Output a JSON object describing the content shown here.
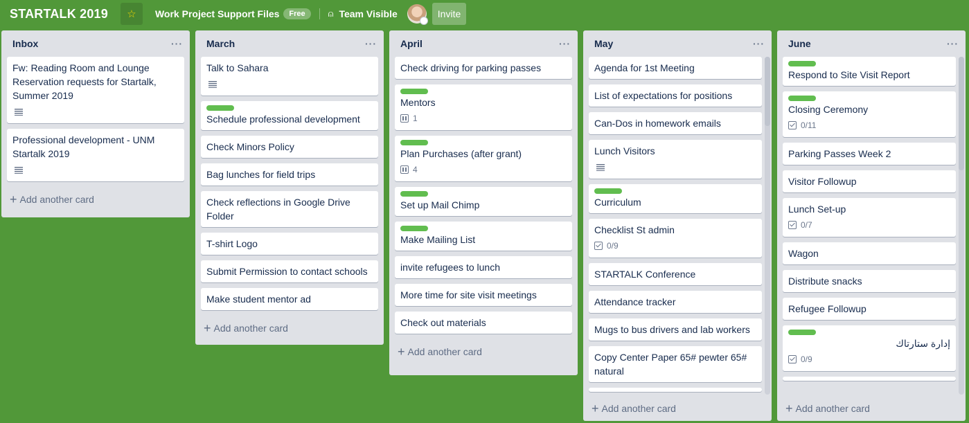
{
  "header": {
    "board_title": "STARTALK 2019",
    "star_icon": "star-icon",
    "team_name": "Work Project Support Files",
    "team_badge": "Free",
    "visibility_icon": "team-visibility-icon",
    "visibility_label": "Team Visible",
    "invite_label": "Invite"
  },
  "colors": {
    "board_bg": "#519839",
    "list_bg": "#dfe1e6",
    "label_green": "#61bd4f",
    "star": "#f2d600"
  },
  "add_card_label": "Add another card",
  "lists": [
    {
      "title": "Inbox",
      "cards": [
        {
          "title": "Fw: Reading Room and Lounge Reservation requests for Startalk, Summer 2019",
          "has_description": true
        },
        {
          "title": "Professional development - UNM Startalk 2019",
          "has_description": true
        }
      ]
    },
    {
      "title": "March",
      "cards": [
        {
          "title": "Talk to Sahara",
          "has_description": true
        },
        {
          "title": "Schedule professional development",
          "label": true
        },
        {
          "title": "Check Minors Policy"
        },
        {
          "title": "Bag lunches for field trips"
        },
        {
          "title": "Check reflections in Google Drive Folder"
        },
        {
          "title": "T-shirt Logo"
        },
        {
          "title": "Submit Permission to contact schools"
        },
        {
          "title": "Make student mentor ad"
        }
      ]
    },
    {
      "title": "April",
      "cards": [
        {
          "title": "Check driving for parking passes"
        },
        {
          "title": "Mentors",
          "label": true,
          "attachments": "1"
        },
        {
          "title": "Plan Purchases (after grant)",
          "label": true,
          "attachments": "4"
        },
        {
          "title": "Set up Mail Chimp",
          "label": true
        },
        {
          "title": "Make Mailing List",
          "label": true
        },
        {
          "title": "invite refugees to lunch"
        },
        {
          "title": "More time for site visit meetings"
        },
        {
          "title": "Check out materials"
        }
      ]
    },
    {
      "title": "May",
      "cards": [
        {
          "title": "Agenda for 1st Meeting"
        },
        {
          "title": "List of expectations for positions"
        },
        {
          "title": "Can-Dos in homework emails"
        },
        {
          "title": "Lunch Visitors",
          "has_description": true
        },
        {
          "title": "Curriculum",
          "label": true
        },
        {
          "title": "Checklist St admin",
          "checklist": "0/9"
        },
        {
          "title": "STARTALK Conference"
        },
        {
          "title": "Attendance tracker"
        },
        {
          "title": "Mugs to bus drivers and lab workers"
        },
        {
          "title": "Copy Center Paper 65# pewter 65# natural"
        }
      ]
    },
    {
      "title": "June",
      "cards": [
        {
          "title": "Respond to Site Visit Report",
          "label": true
        },
        {
          "title": "Closing Ceremony",
          "label": true,
          "checklist": "0/11"
        },
        {
          "title": "Parking Passes Week 2"
        },
        {
          "title": "Visitor Followup"
        },
        {
          "title": "Lunch Set-up",
          "checklist": "0/7"
        },
        {
          "title": "Wagon"
        },
        {
          "title": "Distribute snacks"
        },
        {
          "title": "Refugee Followup"
        },
        {
          "title": "إدارة ستارتاك",
          "label": true,
          "checklist": "0/9",
          "rtl": true
        }
      ]
    }
  ]
}
